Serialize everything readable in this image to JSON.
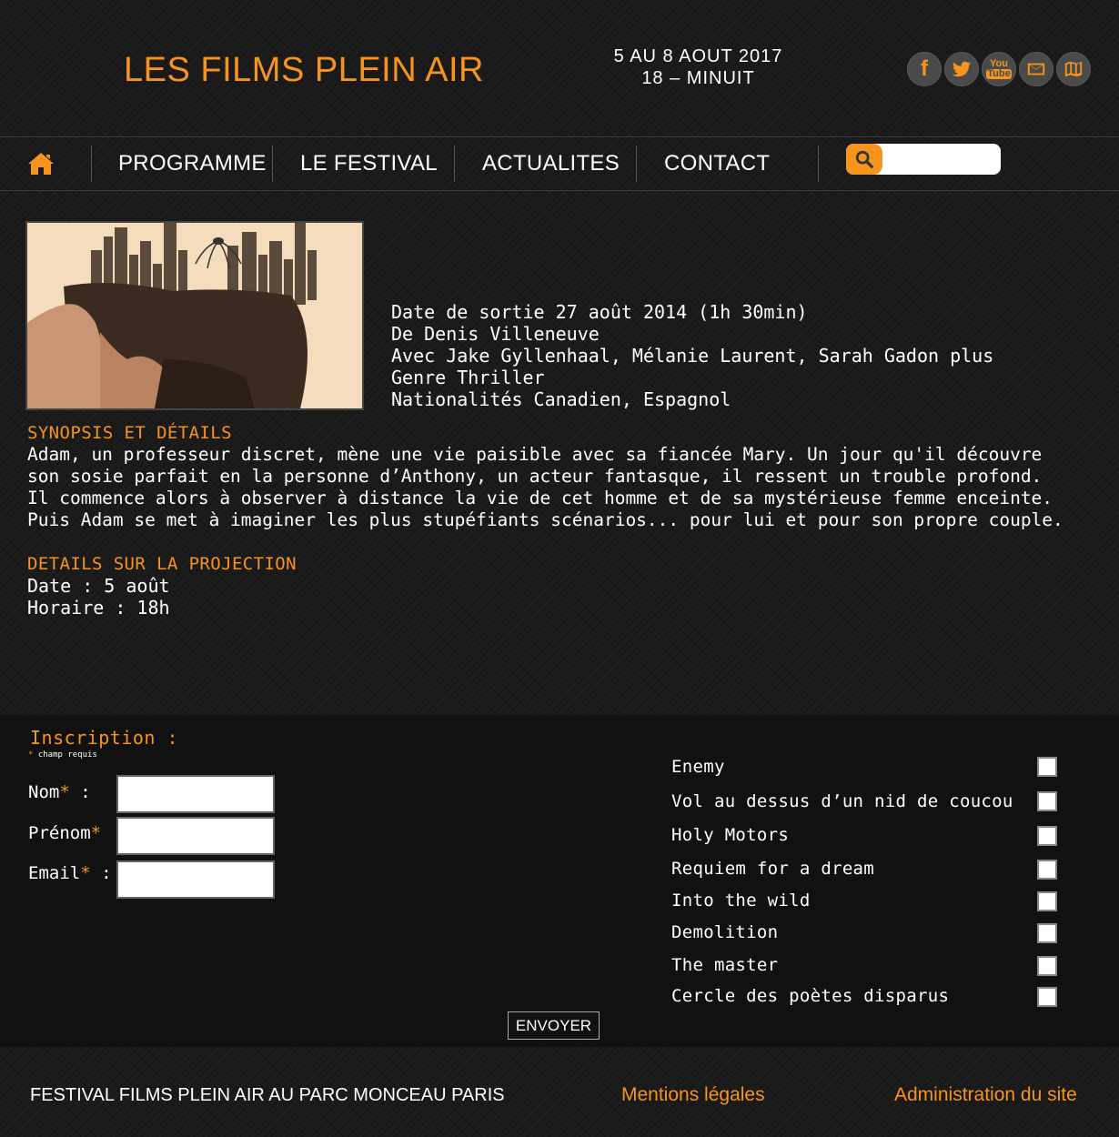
{
  "header": {
    "site_title": "LES FILMS PLEIN AIR",
    "dates_line1": "5 AU 8 AOUT 2017",
    "dates_line2": "18 – MINUIT",
    "social": [
      {
        "icon": "facebook-icon",
        "glyph": "f"
      },
      {
        "icon": "twitter-icon"
      },
      {
        "icon": "youtube-icon",
        "glyph_top": "You",
        "glyph_bottom": "Tube"
      },
      {
        "icon": "envelope-icon"
      },
      {
        "icon": "map-icon"
      }
    ]
  },
  "nav": {
    "home_icon": "home-icon",
    "items": [
      "PROGRAMME",
      "LE FESTIVAL",
      "ACTUALITES",
      "CONTACT"
    ],
    "search": {
      "icon": "search-icon",
      "value": ""
    }
  },
  "film": {
    "poster_alt": "",
    "info": [
      "Date de sortie 27 août 2014 (1h 30min)",
      "De Denis Villeneuve",
      "Avec Jake Gyllenhaal, Mélanie Laurent, Sarah Gadon plus",
      "Genre Thriller",
      "Nationalités Canadien, Espagnol"
    ],
    "synopsis_title": "SYNOPSIS ET DÉTAILS",
    "synopsis": [
      "Adam, un professeur discret, mène une vie paisible avec sa fiancée Mary. Un jour qu'il découvre",
      "son sosie parfait en la personne d’Anthony, un acteur fantasque, il ressent un trouble profond.",
      "Il commence alors à observer à distance la vie de cet homme et de sa mystérieuse femme enceinte.",
      "Puis Adam se met à imaginer les plus stupéfiants scénarios... pour lui et pour son propre couple."
    ],
    "projection_title": "DETAILS SUR LA PROJECTION",
    "projection": [
      "Date : 5 août",
      "Horaire : 18h"
    ]
  },
  "form": {
    "title": "Inscription :",
    "required_star": "*",
    "required_note": " champ requis",
    "fields": [
      {
        "label": "Nom",
        "suffix": " :",
        "value": ""
      },
      {
        "label": "Prénom",
        "suffix": "",
        "value": ""
      },
      {
        "label": "Email",
        "suffix": " :",
        "value": ""
      }
    ],
    "films": [
      "Enemy",
      "Vol au dessus d’un nid de coucou",
      "Holy Motors",
      "Requiem for a dream",
      "Into the wild",
      "Demolition",
      "The master",
      "Cercle des poètes disparus"
    ],
    "submit_label": "ENVOYER"
  },
  "footer": {
    "text": "FESTIVAL FILMS PLEIN AIR AU PARC MONCEAU PARIS",
    "legal": "Mentions légales",
    "admin": "Administration du site"
  },
  "colors": {
    "accent": "#f7941d",
    "background": "#181818",
    "form_background": "#111111"
  }
}
